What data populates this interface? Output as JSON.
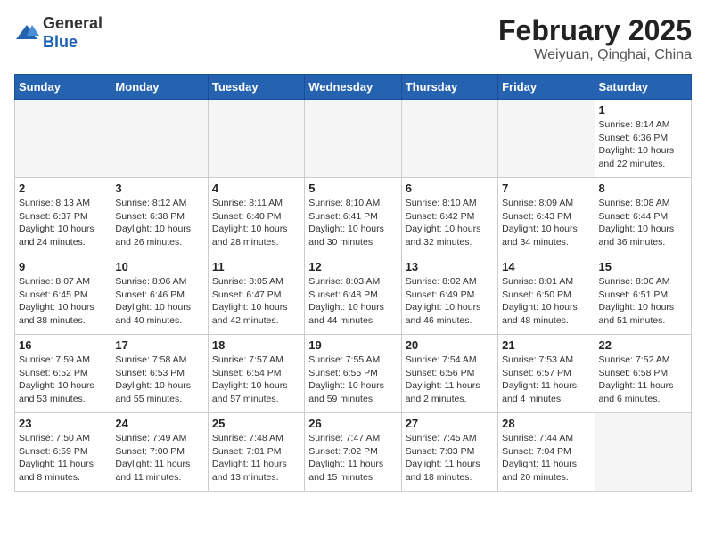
{
  "header": {
    "logo_general": "General",
    "logo_blue": "Blue",
    "title": "February 2025",
    "subtitle": "Weiyuan, Qinghai, China"
  },
  "weekdays": [
    "Sunday",
    "Monday",
    "Tuesday",
    "Wednesday",
    "Thursday",
    "Friday",
    "Saturday"
  ],
  "weeks": [
    [
      {
        "day": "",
        "info": ""
      },
      {
        "day": "",
        "info": ""
      },
      {
        "day": "",
        "info": ""
      },
      {
        "day": "",
        "info": ""
      },
      {
        "day": "",
        "info": ""
      },
      {
        "day": "",
        "info": ""
      },
      {
        "day": "1",
        "info": "Sunrise: 8:14 AM\nSunset: 6:36 PM\nDaylight: 10 hours\nand 22 minutes."
      }
    ],
    [
      {
        "day": "2",
        "info": "Sunrise: 8:13 AM\nSunset: 6:37 PM\nDaylight: 10 hours\nand 24 minutes."
      },
      {
        "day": "3",
        "info": "Sunrise: 8:12 AM\nSunset: 6:38 PM\nDaylight: 10 hours\nand 26 minutes."
      },
      {
        "day": "4",
        "info": "Sunrise: 8:11 AM\nSunset: 6:40 PM\nDaylight: 10 hours\nand 28 minutes."
      },
      {
        "day": "5",
        "info": "Sunrise: 8:10 AM\nSunset: 6:41 PM\nDaylight: 10 hours\nand 30 minutes."
      },
      {
        "day": "6",
        "info": "Sunrise: 8:10 AM\nSunset: 6:42 PM\nDaylight: 10 hours\nand 32 minutes."
      },
      {
        "day": "7",
        "info": "Sunrise: 8:09 AM\nSunset: 6:43 PM\nDaylight: 10 hours\nand 34 minutes."
      },
      {
        "day": "8",
        "info": "Sunrise: 8:08 AM\nSunset: 6:44 PM\nDaylight: 10 hours\nand 36 minutes."
      }
    ],
    [
      {
        "day": "9",
        "info": "Sunrise: 8:07 AM\nSunset: 6:45 PM\nDaylight: 10 hours\nand 38 minutes."
      },
      {
        "day": "10",
        "info": "Sunrise: 8:06 AM\nSunset: 6:46 PM\nDaylight: 10 hours\nand 40 minutes."
      },
      {
        "day": "11",
        "info": "Sunrise: 8:05 AM\nSunset: 6:47 PM\nDaylight: 10 hours\nand 42 minutes."
      },
      {
        "day": "12",
        "info": "Sunrise: 8:03 AM\nSunset: 6:48 PM\nDaylight: 10 hours\nand 44 minutes."
      },
      {
        "day": "13",
        "info": "Sunrise: 8:02 AM\nSunset: 6:49 PM\nDaylight: 10 hours\nand 46 minutes."
      },
      {
        "day": "14",
        "info": "Sunrise: 8:01 AM\nSunset: 6:50 PM\nDaylight: 10 hours\nand 48 minutes."
      },
      {
        "day": "15",
        "info": "Sunrise: 8:00 AM\nSunset: 6:51 PM\nDaylight: 10 hours\nand 51 minutes."
      }
    ],
    [
      {
        "day": "16",
        "info": "Sunrise: 7:59 AM\nSunset: 6:52 PM\nDaylight: 10 hours\nand 53 minutes."
      },
      {
        "day": "17",
        "info": "Sunrise: 7:58 AM\nSunset: 6:53 PM\nDaylight: 10 hours\nand 55 minutes."
      },
      {
        "day": "18",
        "info": "Sunrise: 7:57 AM\nSunset: 6:54 PM\nDaylight: 10 hours\nand 57 minutes."
      },
      {
        "day": "19",
        "info": "Sunrise: 7:55 AM\nSunset: 6:55 PM\nDaylight: 10 hours\nand 59 minutes."
      },
      {
        "day": "20",
        "info": "Sunrise: 7:54 AM\nSunset: 6:56 PM\nDaylight: 11 hours\nand 2 minutes."
      },
      {
        "day": "21",
        "info": "Sunrise: 7:53 AM\nSunset: 6:57 PM\nDaylight: 11 hours\nand 4 minutes."
      },
      {
        "day": "22",
        "info": "Sunrise: 7:52 AM\nSunset: 6:58 PM\nDaylight: 11 hours\nand 6 minutes."
      }
    ],
    [
      {
        "day": "23",
        "info": "Sunrise: 7:50 AM\nSunset: 6:59 PM\nDaylight: 11 hours\nand 8 minutes."
      },
      {
        "day": "24",
        "info": "Sunrise: 7:49 AM\nSunset: 7:00 PM\nDaylight: 11 hours\nand 11 minutes."
      },
      {
        "day": "25",
        "info": "Sunrise: 7:48 AM\nSunset: 7:01 PM\nDaylight: 11 hours\nand 13 minutes."
      },
      {
        "day": "26",
        "info": "Sunrise: 7:47 AM\nSunset: 7:02 PM\nDaylight: 11 hours\nand 15 minutes."
      },
      {
        "day": "27",
        "info": "Sunrise: 7:45 AM\nSunset: 7:03 PM\nDaylight: 11 hours\nand 18 minutes."
      },
      {
        "day": "28",
        "info": "Sunrise: 7:44 AM\nSunset: 7:04 PM\nDaylight: 11 hours\nand 20 minutes."
      },
      {
        "day": "",
        "info": ""
      }
    ]
  ]
}
